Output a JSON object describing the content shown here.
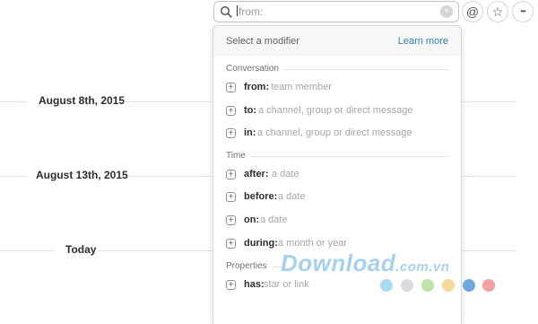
{
  "search": {
    "query": "from:",
    "clear_glyph": "×"
  },
  "header_buttons": {
    "mention_glyph": "@",
    "star_glyph": "☆",
    "more_glyph": "•••"
  },
  "timeline": {
    "days": [
      "August 8th, 2015",
      "August 13th, 2015",
      "Today"
    ]
  },
  "dropdown": {
    "title": "Select a modifier",
    "learn_more": "Learn more",
    "sections": {
      "conversation": "Conversation",
      "time": "Time",
      "properties": "Properties"
    },
    "options": [
      {
        "key": "from:",
        "hint": "team member"
      },
      {
        "key": "to:",
        "hint": "a channel, group or direct message"
      },
      {
        "key": "in:",
        "hint": "a channel, group or direct message"
      },
      {
        "key": "after:",
        "hint": "a date"
      },
      {
        "key": "before:",
        "hint": "a date"
      },
      {
        "key": "on:",
        "hint": "a date"
      },
      {
        "key": "during:",
        "hint": "a month or year"
      },
      {
        "key": "has:",
        "hint": "star or link"
      }
    ]
  },
  "watermark": {
    "text": "Download",
    "suffix": ".com.vn",
    "dot_colors": [
      "#a8dcf0",
      "#dcdcdc",
      "#bfe3a8",
      "#f7d99a",
      "#6fa9dc",
      "#f2a0a0"
    ]
  },
  "colors": {
    "accent_link": "#2a80b9",
    "hint_text": "#a6a6a6"
  }
}
